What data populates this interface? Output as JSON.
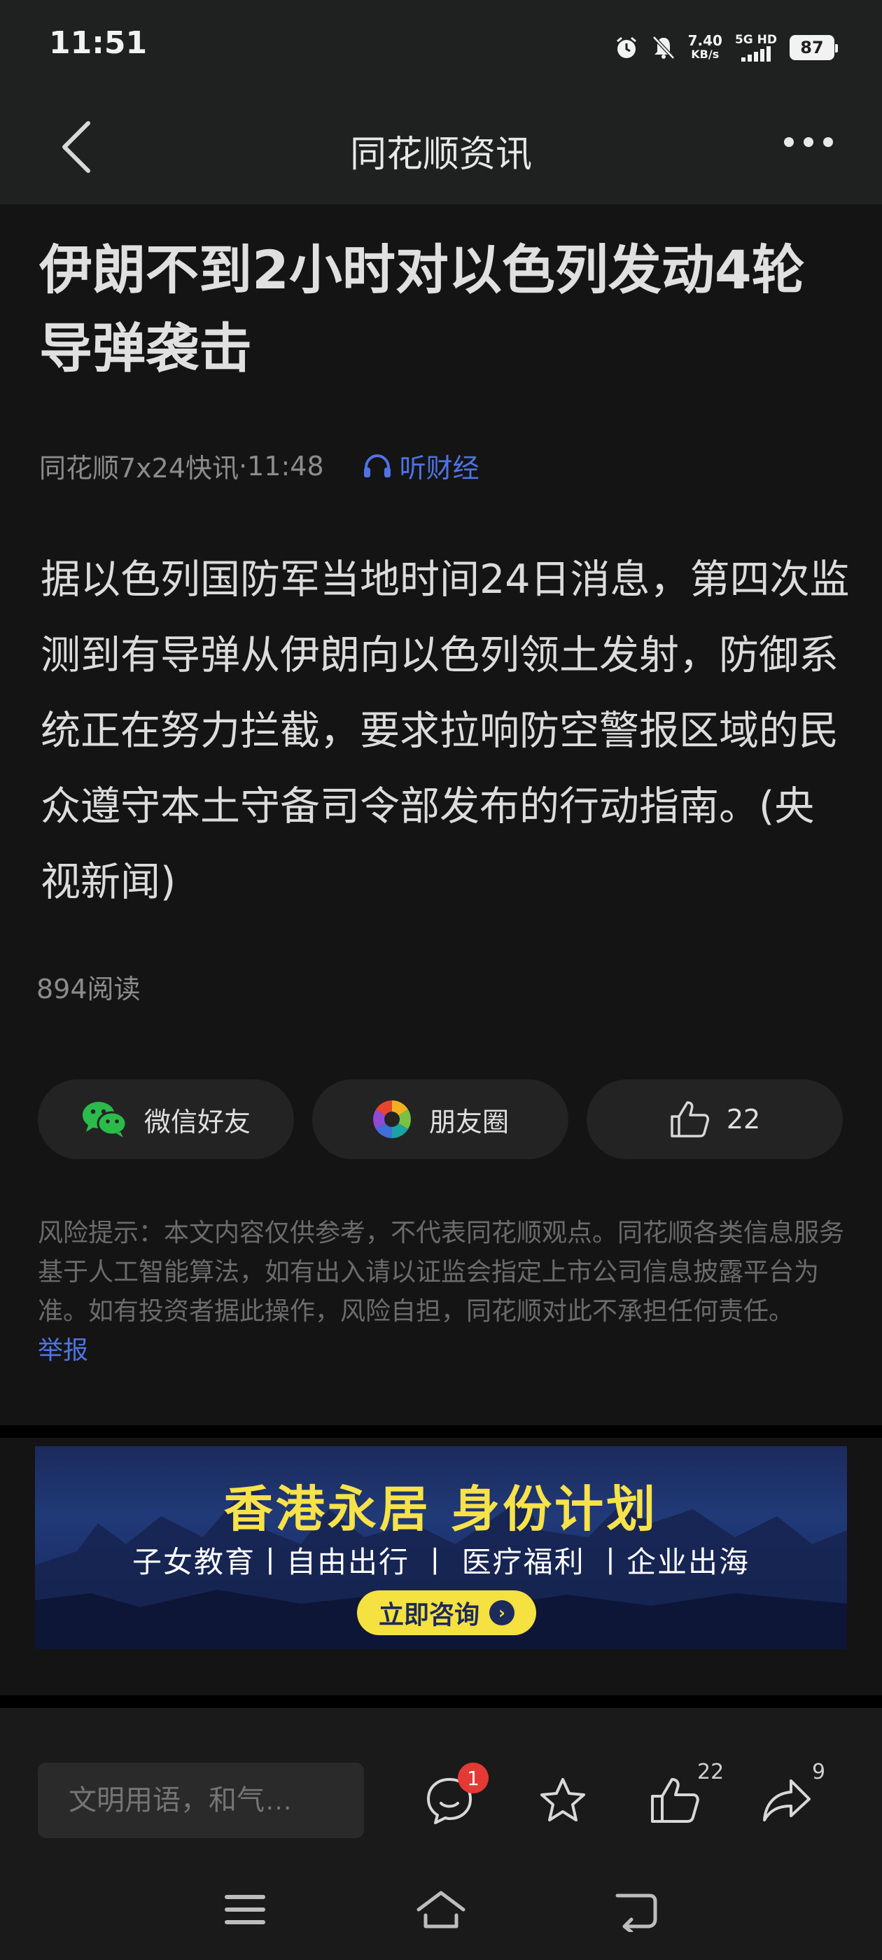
{
  "status_bar": {
    "time": "11:51",
    "net_speed": "7.40",
    "net_speed_unit": "KB/s",
    "network": "5G HD",
    "battery": "87",
    "icons": [
      "alarm-icon",
      "mute-bell-icon",
      "signal-icon",
      "battery-icon"
    ]
  },
  "nav": {
    "title": "同花顺资讯",
    "back_icon": "chevron-left-icon",
    "more_icon": "more-dots-icon"
  },
  "article": {
    "headline": "伊朗不到2小时对以色列发动4轮导弹袭击",
    "source": "同花顺7x24快讯",
    "time": "11:48",
    "separator": "·",
    "listen_label": "听财经",
    "body": "据以色列国防军当地时间24日消息，第四次监测到有导弹从伊朗向以色列领土发射，防御系统正在努力拦截，要求拉响防空警报区域的民众遵守本土守备司令部发布的行动指南。(央视新闻)",
    "reads": "894阅读"
  },
  "share": {
    "wechat_label": "微信好友",
    "moments_label": "朋友圈",
    "like_count": "22"
  },
  "risk": {
    "text": "风险提示：本文内容仅供参考，不代表同花顺观点。同花顺各类信息服务基于人工智能算法，如有出入请以证监会指定上市公司信息披露平台为准。如有投资者据此操作，风险自担，同花顺对此不承担任何责任。",
    "report_label": "举报"
  },
  "ad": {
    "title": "香港永居 身份计划",
    "subtitle": "子女教育丨自由出行 丨 医疗福利 丨企业出海",
    "cta": "立即咨询"
  },
  "bottom_bar": {
    "comment_placeholder": "文明用语，和气…",
    "comment_badge": "1",
    "like_count": "22",
    "share_count": "9"
  },
  "colors": {
    "background": "#141414",
    "accent_blue": "#4f73e6",
    "ad_yellow": "#f7e24a",
    "badge_red": "#e53935"
  }
}
